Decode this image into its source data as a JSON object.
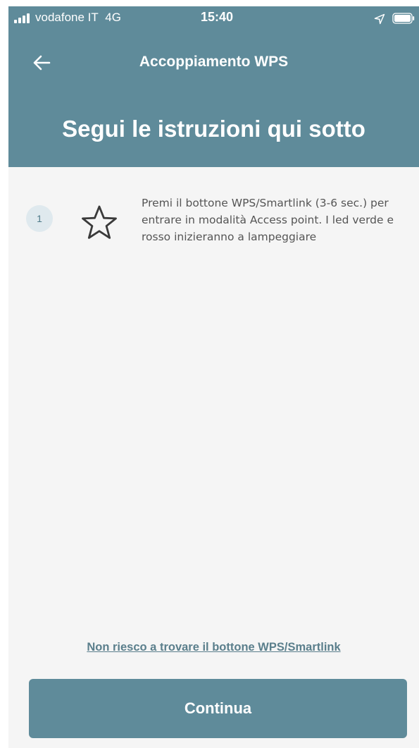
{
  "status_bar": {
    "carrier": "vodafone IT",
    "network": "4G",
    "time": "15:40"
  },
  "nav": {
    "title": "Accoppiamento WPS",
    "back_icon": "arrow-left-icon"
  },
  "page": {
    "title": "Segui le istruzioni qui sotto"
  },
  "steps": [
    {
      "number": "1",
      "icon": "star-outline-icon",
      "text": "Premi il bottone WPS/Smartlink (3-6 sec.) per entrare in modalità Access point. I led verde e rosso inizieranno a lampeggiare"
    }
  ],
  "help_link": "Non riesco a trovare il bottone WPS/Smartlink",
  "continue_label": "Continua",
  "colors": {
    "header": "#5f8b9a",
    "button": "#5f8b9a",
    "link": "#5b7f8c",
    "step_badge": "#dfe9ee"
  }
}
